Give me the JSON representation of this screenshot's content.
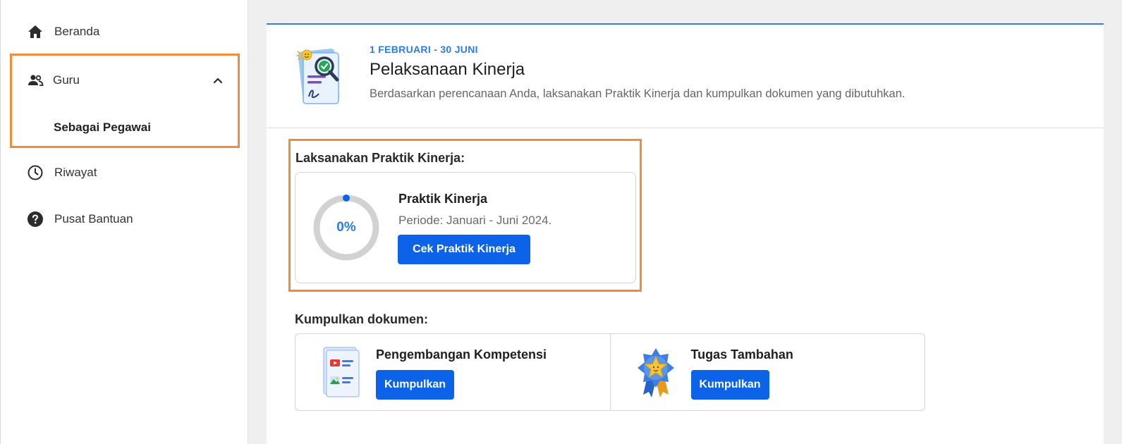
{
  "sidebar": {
    "items": [
      {
        "label": "Beranda",
        "icon": "home-icon"
      },
      {
        "label": "Guru",
        "icon": "people-icon",
        "expanded": true,
        "sub_items": [
          {
            "label": "Sebagai Pegawai"
          }
        ]
      },
      {
        "label": "Riwayat",
        "icon": "clock-icon"
      },
      {
        "label": "Pusat Bantuan",
        "icon": "help-icon"
      }
    ]
  },
  "header": {
    "date_range": "1 FEBRUARI - 30 JUNI",
    "title": "Pelaksanaan Kinerja",
    "description": "Berdasarkan perencanaan Anda, laksanakan Praktik Kinerja dan kumpulkan dokumen yang dibutuhkan."
  },
  "praktik": {
    "heading": "Laksanakan Praktik Kinerja:",
    "card": {
      "title": "Praktik Kinerja",
      "period": "Periode: Januari - Juni 2024.",
      "progress_label": "0%",
      "progress_value": 0,
      "button_label": "Cek Praktik Kinerja"
    }
  },
  "documents": {
    "heading": "Kumpulkan dokumen:",
    "items": [
      {
        "title": "Pengembangan Kompetensi",
        "button_label": "Kumpulkan",
        "icon": "document-media-icon"
      },
      {
        "title": "Tugas Tambahan",
        "button_label": "Kumpulkan",
        "icon": "star-badge-icon"
      }
    ]
  },
  "colors": {
    "accent": "#0d63e8",
    "highlight_border": "#f08c3a",
    "date_text": "#2e7be0"
  }
}
